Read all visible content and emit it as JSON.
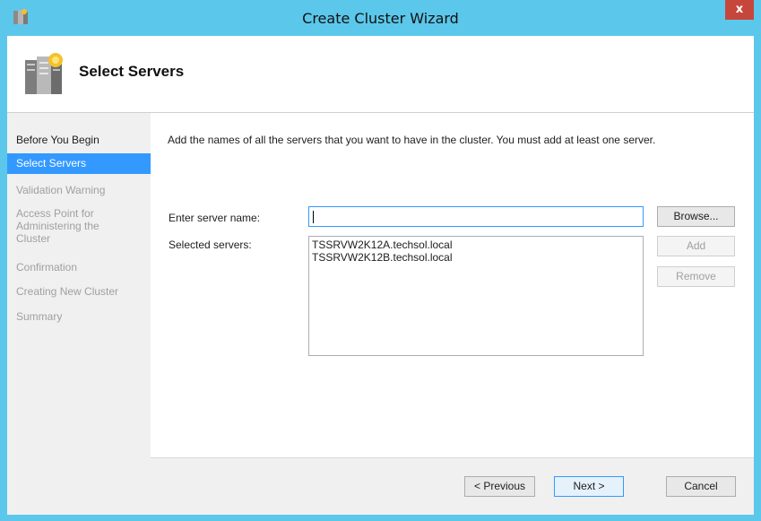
{
  "window": {
    "title": "Create Cluster Wizard",
    "close_label": "x"
  },
  "header": {
    "title": "Select Servers"
  },
  "steps": [
    {
      "label": "Before You Begin",
      "state": "done"
    },
    {
      "label": "Select Servers",
      "state": "selected"
    },
    {
      "label": "Validation Warning",
      "state": "pending"
    },
    {
      "label": "Access Point for Administering the Cluster",
      "state": "pending"
    },
    {
      "label": "Confirmation",
      "state": "pending"
    },
    {
      "label": "Creating New Cluster",
      "state": "pending"
    },
    {
      "label": "Summary",
      "state": "pending"
    }
  ],
  "main": {
    "instructions": "Add the names of all the servers that you want to have in the cluster. You must add at least one server.",
    "server_name_label": "Enter server name:",
    "server_name_value": "",
    "selected_servers_label": "Selected servers:",
    "selected_servers": [
      "TSSRVW2K12A.techsol.local",
      "TSSRVW2K12B.techsol.local"
    ],
    "browse_label": "Browse...",
    "add_label": "Add",
    "remove_label": "Remove"
  },
  "footer": {
    "previous_label": "< Previous",
    "next_label": "Next >",
    "cancel_label": "Cancel"
  },
  "colors": {
    "titlebar": "#5bc7ea",
    "selection": "#3399ff",
    "close": "#c7463b"
  }
}
